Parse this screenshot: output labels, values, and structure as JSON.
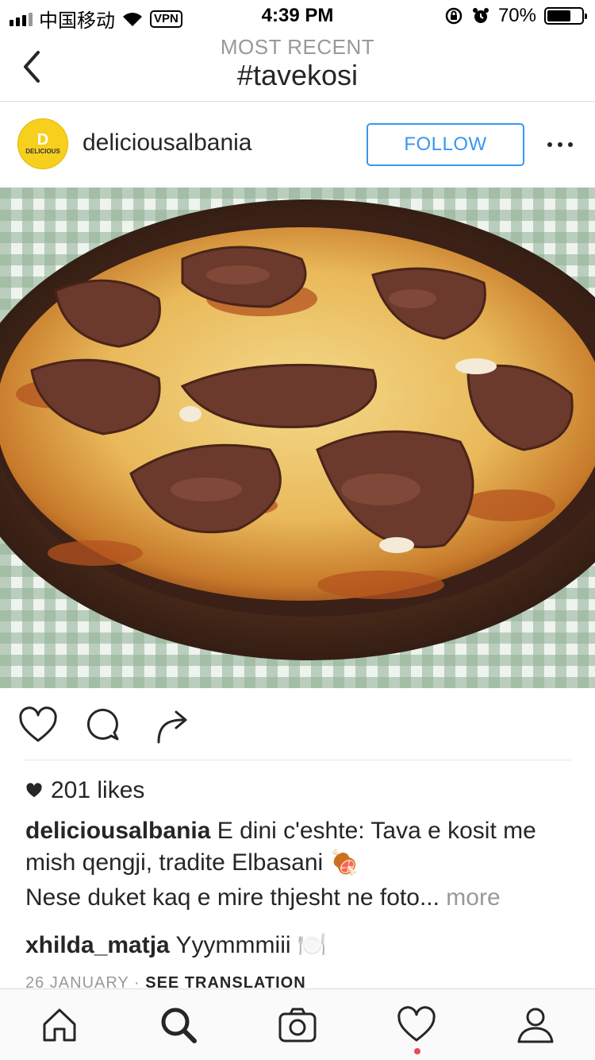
{
  "status_bar": {
    "carrier": "中国移动",
    "vpn": "VPN",
    "time": "4:39 PM",
    "battery": "70%",
    "battery_level": 0.7
  },
  "header": {
    "subtitle": "MOST RECENT",
    "title": "#tavekosi"
  },
  "post": {
    "avatar_brand": "DELICIOUS",
    "avatar_mark": "D",
    "username": "deliciousalbania",
    "follow_label": "FOLLOW",
    "likes": "201 likes",
    "caption_user": "deliciousalbania",
    "caption_text": "E dini c'eshte: Tava e kosit me mish qengji, tradite Elbasani 🍖",
    "caption_line2": "Nese duket kaq e mire thjesht ne foto...",
    "more_label": "more",
    "comment_user": "xhilda_matja",
    "comment_text": "Yyymmmiii 🍽️",
    "date": "26 JANUARY",
    "separator": "·",
    "see_translation": "SEE TRANSLATION"
  },
  "colors": {
    "accent": "#3897f0",
    "text": "#262626",
    "muted": "#999999",
    "notification": "#ed4956",
    "avatar_bg": "#f7cf1d"
  },
  "tabs": [
    {
      "icon": "home-icon"
    },
    {
      "icon": "search-icon"
    },
    {
      "icon": "camera-icon"
    },
    {
      "icon": "heart-icon"
    },
    {
      "icon": "profile-icon"
    }
  ]
}
